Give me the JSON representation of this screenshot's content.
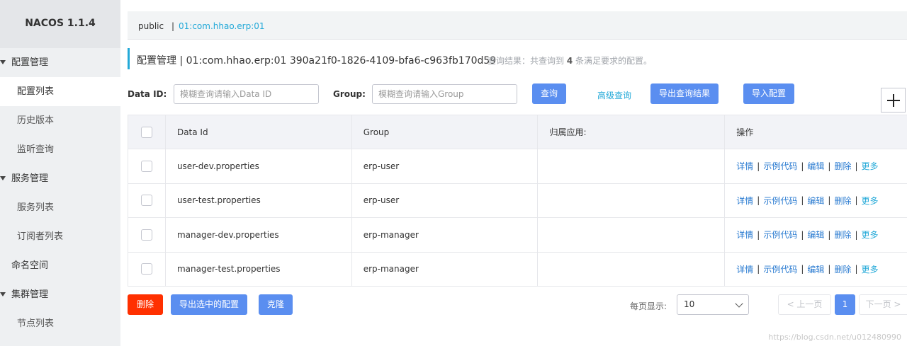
{
  "sidebar": {
    "brand": "NACOS 1.1.4",
    "items": [
      {
        "label": "配置管理",
        "type": "group"
      },
      {
        "label": "配置列表",
        "type": "sub",
        "active": true
      },
      {
        "label": "历史版本",
        "type": "sub"
      },
      {
        "label": "监听查询",
        "type": "sub"
      },
      {
        "label": "服务管理",
        "type": "group"
      },
      {
        "label": "服务列表",
        "type": "sub"
      },
      {
        "label": "订阅者列表",
        "type": "sub"
      },
      {
        "label": "命名空间",
        "type": "plain"
      },
      {
        "label": "集群管理",
        "type": "group"
      },
      {
        "label": "节点列表",
        "type": "sub"
      }
    ]
  },
  "namespace": {
    "public": "public",
    "separator": "|",
    "current": "01:com.hhao.erp:01"
  },
  "header": {
    "title": "配置管理  |  01:com.hhao.erp:01  390a21f0-1826-4109-bfa6-c963fb170d59",
    "result_prefix": "查询结果：共查询到 ",
    "result_count": "4",
    "result_suffix": " 条满足要求的配置。"
  },
  "search": {
    "data_id_label": "Data ID:",
    "data_id_placeholder": "模糊查询请输入Data ID",
    "group_label": "Group:",
    "group_placeholder": "模糊查询请输入Group",
    "query_button": "查询",
    "advanced_query": "高级查询",
    "export_results": "导出查询结果",
    "import_config": "导入配置"
  },
  "table": {
    "columns": [
      "Data Id",
      "Group",
      "归属应用:",
      "操作"
    ],
    "rows": [
      {
        "data_id": "user-dev.properties",
        "group": "erp-user",
        "app": ""
      },
      {
        "data_id": "user-test.properties",
        "group": "erp-user",
        "app": ""
      },
      {
        "data_id": "manager-dev.properties",
        "group": "erp-manager",
        "app": ""
      },
      {
        "data_id": "manager-test.properties",
        "group": "erp-manager",
        "app": ""
      }
    ],
    "operations": {
      "detail": "详情",
      "sample_code": "示例代码",
      "edit": "编辑",
      "delete": "删除",
      "more": "更多",
      "sep": "|"
    }
  },
  "footer": {
    "delete": "删除",
    "export_selected": "导出选中的配置",
    "clone": "克隆",
    "page_size_label": "每页显示:",
    "page_size": "10",
    "prev": "< 上一页",
    "current_page": "1",
    "next": "下一页 >"
  },
  "watermark": "https://blog.csdn.net/u012480990",
  "colors": {
    "primary": "#5a8ef0",
    "link": "#23a9d8",
    "danger": "#ff3000",
    "sidebar_bg": "#eef0f2"
  }
}
